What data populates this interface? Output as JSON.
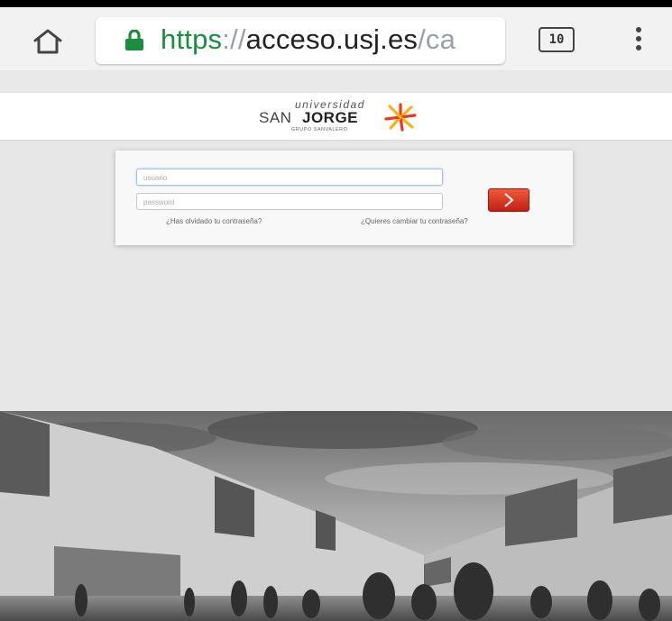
{
  "browser": {
    "url_scheme": "https",
    "url_separator": "://",
    "url_host": "acceso.usj.es",
    "url_rest": "/ca",
    "tab_count": "10",
    "icons": [
      "home-icon",
      "lock-icon",
      "tab-switcher-icon",
      "overflow-menu-icon"
    ],
    "colors": {
      "secure": "#1a8e3f",
      "toolbar": "#f2f2f2"
    }
  },
  "site": {
    "logo": {
      "line1": "universidad",
      "san": "SAN",
      "jorge": "JORGE",
      "group": "GRUPO SANVALERO"
    }
  },
  "login": {
    "username_placeholder": "usuario",
    "password_placeholder": "password",
    "forgot_link": "¿Has olvidado tu contraseña?",
    "change_link": "¿Quieres cambiar tu contraseña?",
    "submit_icon": "chevron-right-icon",
    "submit_color": "#e0402a"
  }
}
